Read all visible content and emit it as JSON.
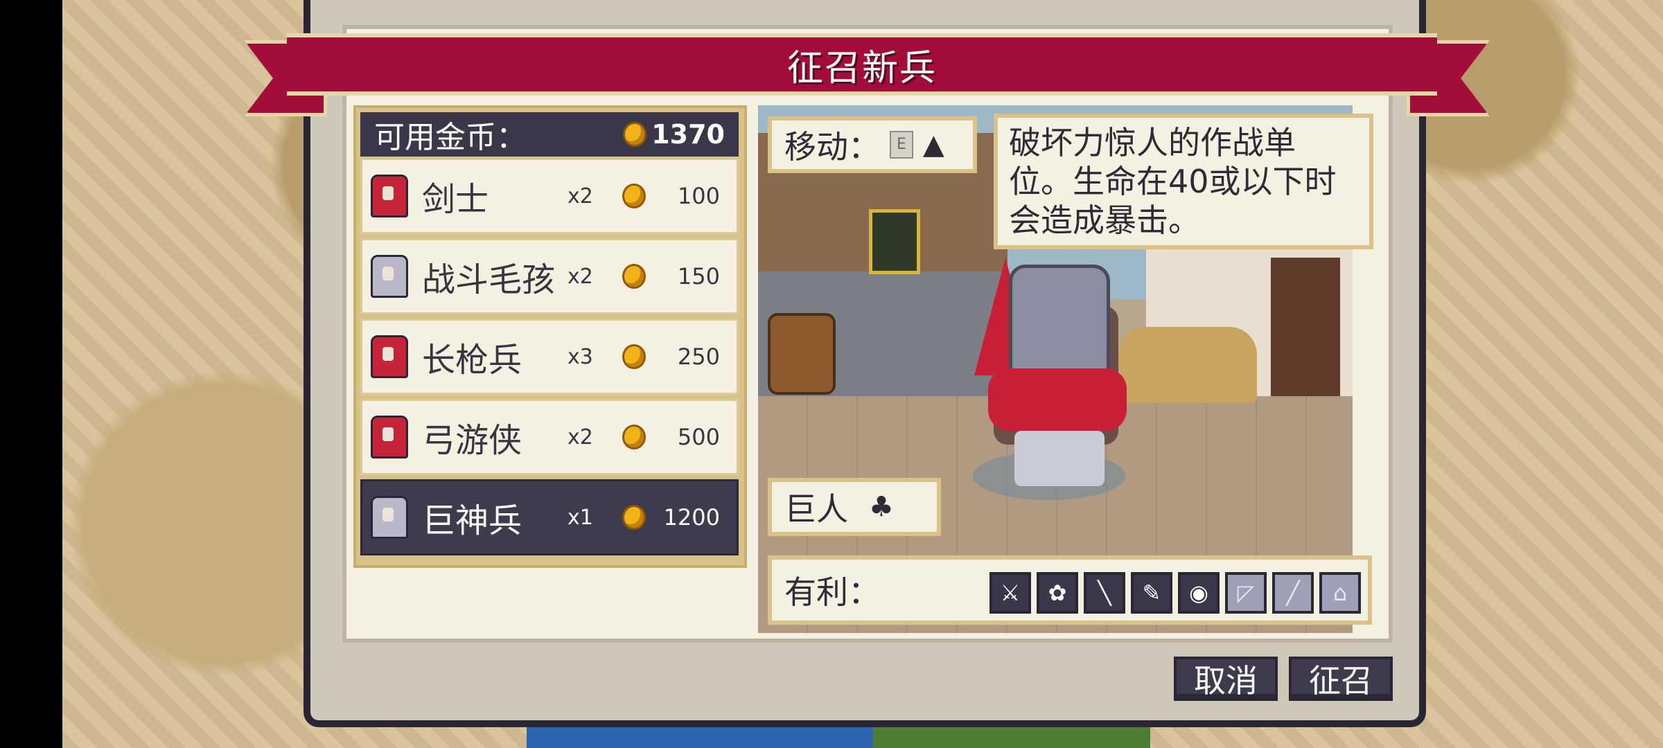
{
  "title": "征召新兵",
  "gold": {
    "label": "可用金币：",
    "amount": "1370"
  },
  "units": [
    {
      "name": "剑士",
      "count": "x2",
      "cost": "100",
      "portrait": "swordsman-portrait",
      "selected": false
    },
    {
      "name": "战斗毛孩",
      "count": "x2",
      "cost": "150",
      "portrait": "dog-portrait",
      "selected": false
    },
    {
      "name": "长枪兵",
      "count": "x3",
      "cost": "250",
      "portrait": "pikeman-portrait",
      "selected": false
    },
    {
      "name": "弓游侠",
      "count": "x2",
      "cost": "500",
      "portrait": "archer-portrait",
      "selected": false
    },
    {
      "name": "巨神兵",
      "count": "x1",
      "cost": "1200",
      "portrait": "giant-portrait",
      "selected": true
    }
  ],
  "detail": {
    "move_label": "移动：",
    "move_value_icon": "E",
    "move_type_icon": "mountain-icon",
    "description": "破坏力惊人的作战单位。生命在40或以下时会造成暴击。",
    "unit_class": "巨人",
    "unit_class_icon": "giant-class-icon",
    "advantage_label": "有利：",
    "advantage_icons": [
      {
        "name": "pikeman-icon",
        "glyph": "⚔",
        "dim": false
      },
      {
        "name": "paw-icon",
        "glyph": "✿",
        "dim": false
      },
      {
        "name": "sword-icon",
        "glyph": "╲",
        "dim": false
      },
      {
        "name": "staff-icon",
        "glyph": "✎",
        "dim": false
      },
      {
        "name": "cavalry-icon",
        "glyph": "◉",
        "dim": false
      },
      {
        "name": "ballista-icon",
        "glyph": "◸",
        "dim": true
      },
      {
        "name": "spear-icon",
        "glyph": "╱",
        "dim": true
      },
      {
        "name": "building-icon",
        "glyph": "⌂",
        "dim": true
      }
    ]
  },
  "buttons": {
    "cancel": "取消",
    "recruit": "征召"
  },
  "colors": {
    "ribbon": "#a30d3a",
    "panel_dark": "#3b364a",
    "parchment": "#f4f1e3",
    "gold": "#f0b318"
  }
}
